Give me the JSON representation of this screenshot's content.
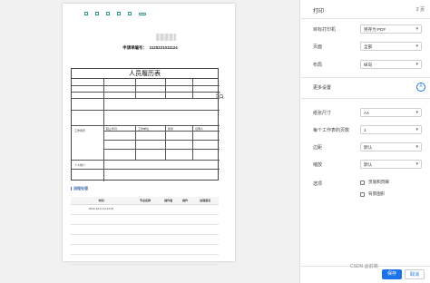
{
  "print_preview": {
    "checkboxes": [
      "",
      "",
      "",
      "",
      ""
    ],
    "confirm_button": "",
    "doc_number_label": "申请单编号：",
    "doc_number_value": "1120221011124",
    "section_basic": "",
    "section_flow": "流程处理",
    "resume": {
      "title": "人员履历表",
      "labels": [
        "",
        "",
        "",
        "",
        "",
        "",
        "",
        "",
        "",
        "",
        "",
        "",
        "",
        "",
        "",
        "",
        "",
        "",
        "",
        "",
        "",
        "",
        "",
        "",
        "个人简介"
      ],
      "work_labels": [
        "工作简历",
        "起止年月",
        "工作单位",
        "职务",
        "证明人"
      ]
    },
    "flow_table": {
      "headers": [
        "时间",
        "节点名称",
        "操作者",
        "操作",
        "处理意见"
      ],
      "rows": [
        [
          "2022-10-11 11:24:07",
          "",
          "",
          "",
          ""
        ],
        [
          "",
          "",
          "",
          "",
          ""
        ],
        [
          "",
          "",
          "",
          "",
          ""
        ],
        [
          "",
          "",
          "",
          "",
          ""
        ],
        [
          "",
          "",
          "",
          "",
          ""
        ],
        [
          "",
          "",
          "",
          "",
          ""
        ]
      ]
    }
  },
  "settings": {
    "title": "打印",
    "page_count": "2 页",
    "rows": [
      {
        "label": "目标打印机",
        "value": "另存为 PDF"
      },
      {
        "label": "页面",
        "value": "全部"
      },
      {
        "label": "布局",
        "value": "纵向"
      }
    ],
    "more_settings": "更多设置",
    "rows2": [
      {
        "label": "纸张尺寸",
        "value": "A4"
      },
      {
        "label": "每个工作表的页数",
        "value": "1"
      },
      {
        "label": "边距",
        "value": "默认"
      },
      {
        "label": "缩放",
        "value": "默认"
      }
    ],
    "options_label": "选项",
    "options": [
      "页眉和页脚",
      "背景图形"
    ],
    "save_button": "保存",
    "cancel_button": "取消"
  },
  "watermark": "CSDN @前端"
}
